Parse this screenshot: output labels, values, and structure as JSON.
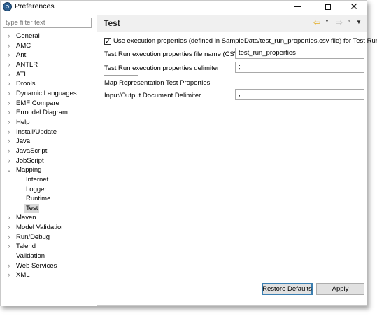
{
  "window": {
    "title": "Preferences",
    "app_icon": "eclipse-icon",
    "controls": {
      "minimize": "minimize-icon",
      "maximize": "maximize-icon",
      "close": "✕"
    }
  },
  "filter": {
    "placeholder": "type filter text",
    "value": ""
  },
  "tree": {
    "items": [
      {
        "label": "General",
        "expander": "›",
        "level": 0
      },
      {
        "label": "AMC",
        "expander": "›",
        "level": 0
      },
      {
        "label": "Ant",
        "expander": "›",
        "level": 0
      },
      {
        "label": "ANTLR",
        "expander": "›",
        "level": 0
      },
      {
        "label": "ATL",
        "expander": "›",
        "level": 0
      },
      {
        "label": "Drools",
        "expander": "›",
        "level": 0
      },
      {
        "label": "Dynamic Languages",
        "expander": "›",
        "level": 0
      },
      {
        "label": "EMF Compare",
        "expander": "›",
        "level": 0
      },
      {
        "label": "Ermodel Diagram",
        "expander": "›",
        "level": 0
      },
      {
        "label": "Help",
        "expander": "›",
        "level": 0
      },
      {
        "label": "Install/Update",
        "expander": "›",
        "level": 0
      },
      {
        "label": "Java",
        "expander": "›",
        "level": 0
      },
      {
        "label": "JavaScript",
        "expander": "›",
        "level": 0
      },
      {
        "label": "JobScript",
        "expander": "›",
        "level": 0
      },
      {
        "label": "Mapping",
        "expander": "⌄",
        "level": 0
      },
      {
        "label": "Internet",
        "expander": "",
        "level": 1
      },
      {
        "label": "Logger",
        "expander": "",
        "level": 1
      },
      {
        "label": "Runtime",
        "expander": "",
        "level": 1
      },
      {
        "label": "Test",
        "expander": "",
        "level": 1,
        "selected": true
      },
      {
        "label": "Maven",
        "expander": "›",
        "level": 0
      },
      {
        "label": "Model Validation",
        "expander": "›",
        "level": 0
      },
      {
        "label": "Run/Debug",
        "expander": "›",
        "level": 0
      },
      {
        "label": "Talend",
        "expander": "›",
        "level": 0
      },
      {
        "label": "Validation",
        "expander": "",
        "level": 0
      },
      {
        "label": "Web Services",
        "expander": "›",
        "level": 0
      },
      {
        "label": "XML",
        "expander": "›",
        "level": 0
      }
    ]
  },
  "page": {
    "title": "Test",
    "nav": {
      "back": "⇦",
      "back_dropdown": "▼",
      "forward": "⇨",
      "forward_dropdown": "▼",
      "menu": "▼"
    },
    "use_exec_props": {
      "checked": true,
      "check_glyph": "✓",
      "label": "Use execution properties (defined in SampleData/test_run_properties.csv file) for Test Run"
    },
    "file_name": {
      "label": "Test Run execution properties file name (CSV)",
      "value": "test_run_properties"
    },
    "delimiter": {
      "label": "Test Run execution properties delimiter",
      "value": ";"
    },
    "map_section_label": "Map Representation Test Properties",
    "io_delimiter": {
      "label": "Input/Output Document Delimiter",
      "value": ","
    }
  },
  "buttons": {
    "restore_defaults": "Restore Defaults",
    "apply": "Apply"
  },
  "colors": {
    "back_arrow": "#e0a000",
    "header_bg": "#f0f0f0",
    "selection_bg": "#d9d9d9",
    "default_button_border": "#3c7fb1"
  }
}
